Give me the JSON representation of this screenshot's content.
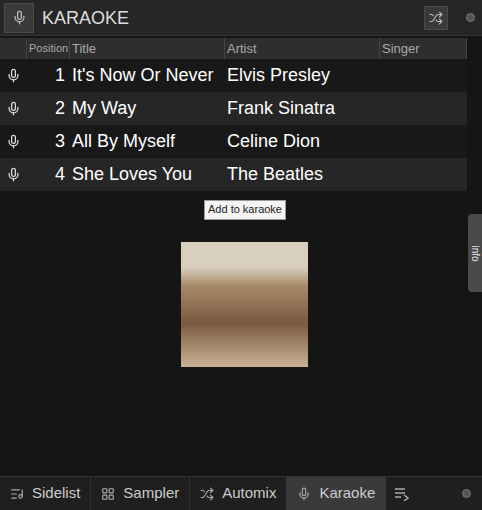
{
  "window": {
    "title": "KARAOKE"
  },
  "table": {
    "columns": [
      "Position",
      "Title",
      "Artist",
      "Singer"
    ],
    "rows": [
      {
        "position": "1",
        "title": "It's Now Or Never",
        "artist": "Elvis Presley"
      },
      {
        "position": "2",
        "title": "My Way",
        "artist": "Frank Sinatra"
      },
      {
        "position": "3",
        "title": "All By Myself",
        "artist": "Celine Dion"
      },
      {
        "position": "4",
        "title": "She Loves You",
        "artist": "The Beatles"
      }
    ]
  },
  "tooltip": "Add to karaoke",
  "info_tab": "info",
  "tabs": [
    {
      "label": "Sidelist",
      "selected": false
    },
    {
      "label": "Sampler",
      "selected": false
    },
    {
      "label": "Automix",
      "selected": false
    },
    {
      "label": "Karaoke",
      "selected": true
    }
  ]
}
